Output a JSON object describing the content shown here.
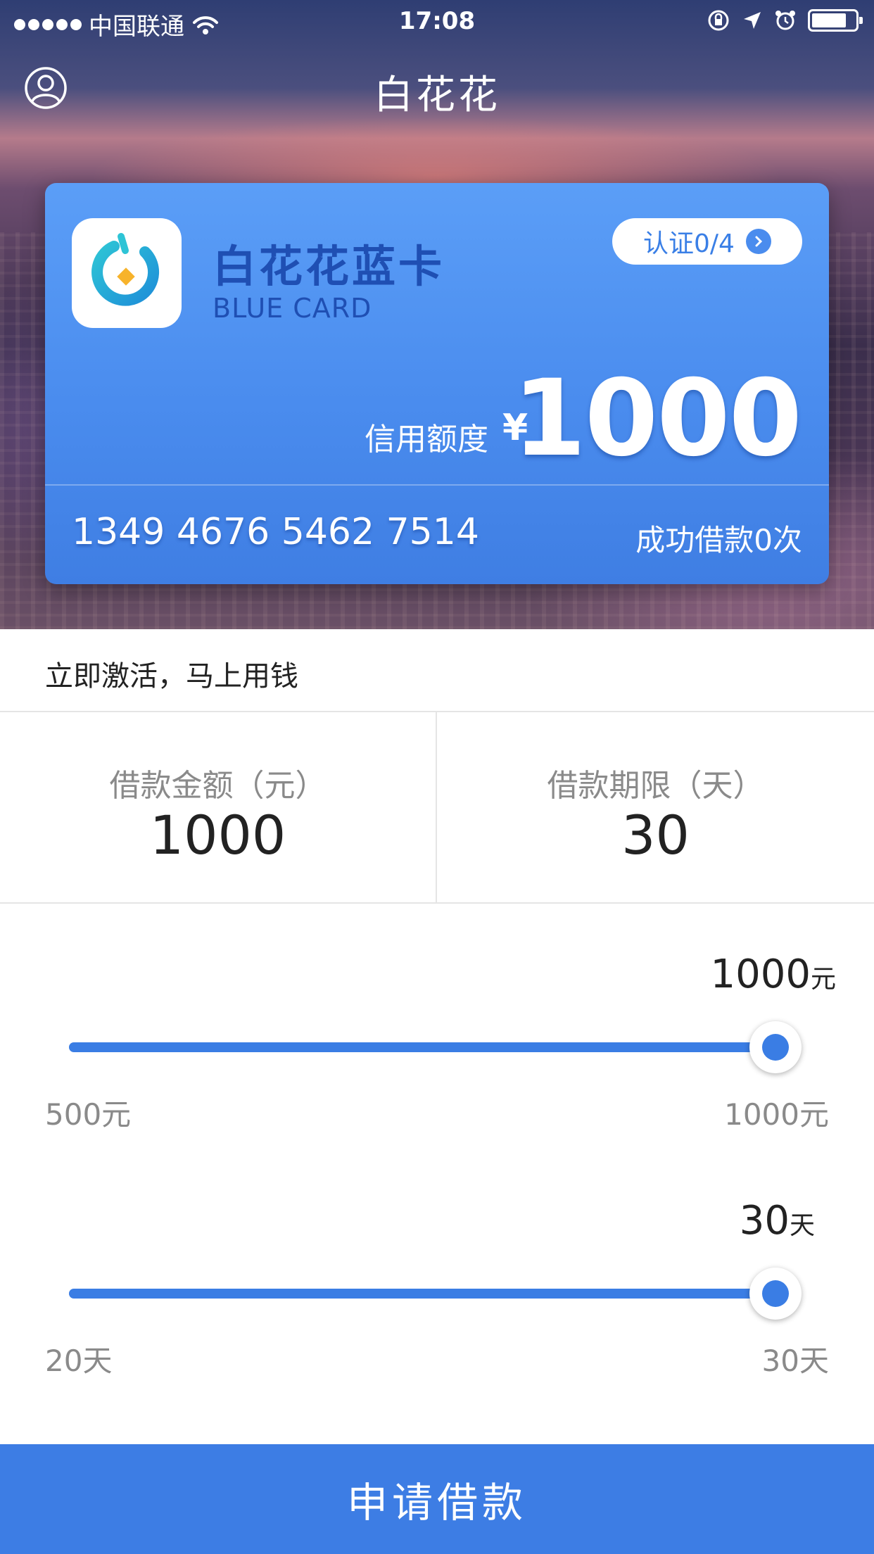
{
  "status_bar": {
    "carrier": "中国联通",
    "time": "17:08"
  },
  "nav": {
    "title": "白花花",
    "profile_icon": "user-circle-icon"
  },
  "card": {
    "title": "白花花蓝卡",
    "subtitle": "BLUE CARD",
    "verify_label": "认证0/4",
    "credit_label": "信用额度",
    "currency_symbol": "¥",
    "credit_amount": "1000",
    "card_number": "1349 4676 5462 7514",
    "loan_count_text": "成功借款0次",
    "colors": {
      "card_top": "#5b9ef7",
      "card_bottom": "#3f7ee3",
      "title": "#1f4fb3"
    }
  },
  "notice": {
    "text": "立即激活，马上用钱"
  },
  "summary": {
    "amount_label": "借款金额（元）",
    "amount_value": "1000",
    "term_label": "借款期限（天）",
    "term_value": "30"
  },
  "amount_slider": {
    "current_value": "1000",
    "current_unit": "元",
    "min_label": "500元",
    "max_label": "1000元",
    "fraction": 1.0
  },
  "term_slider": {
    "current_value": "30",
    "current_unit": "天",
    "min_label": "20天",
    "max_label": "30天",
    "fraction": 1.0
  },
  "apply_button": {
    "label": "申请借款",
    "color": "#3d7de4"
  }
}
